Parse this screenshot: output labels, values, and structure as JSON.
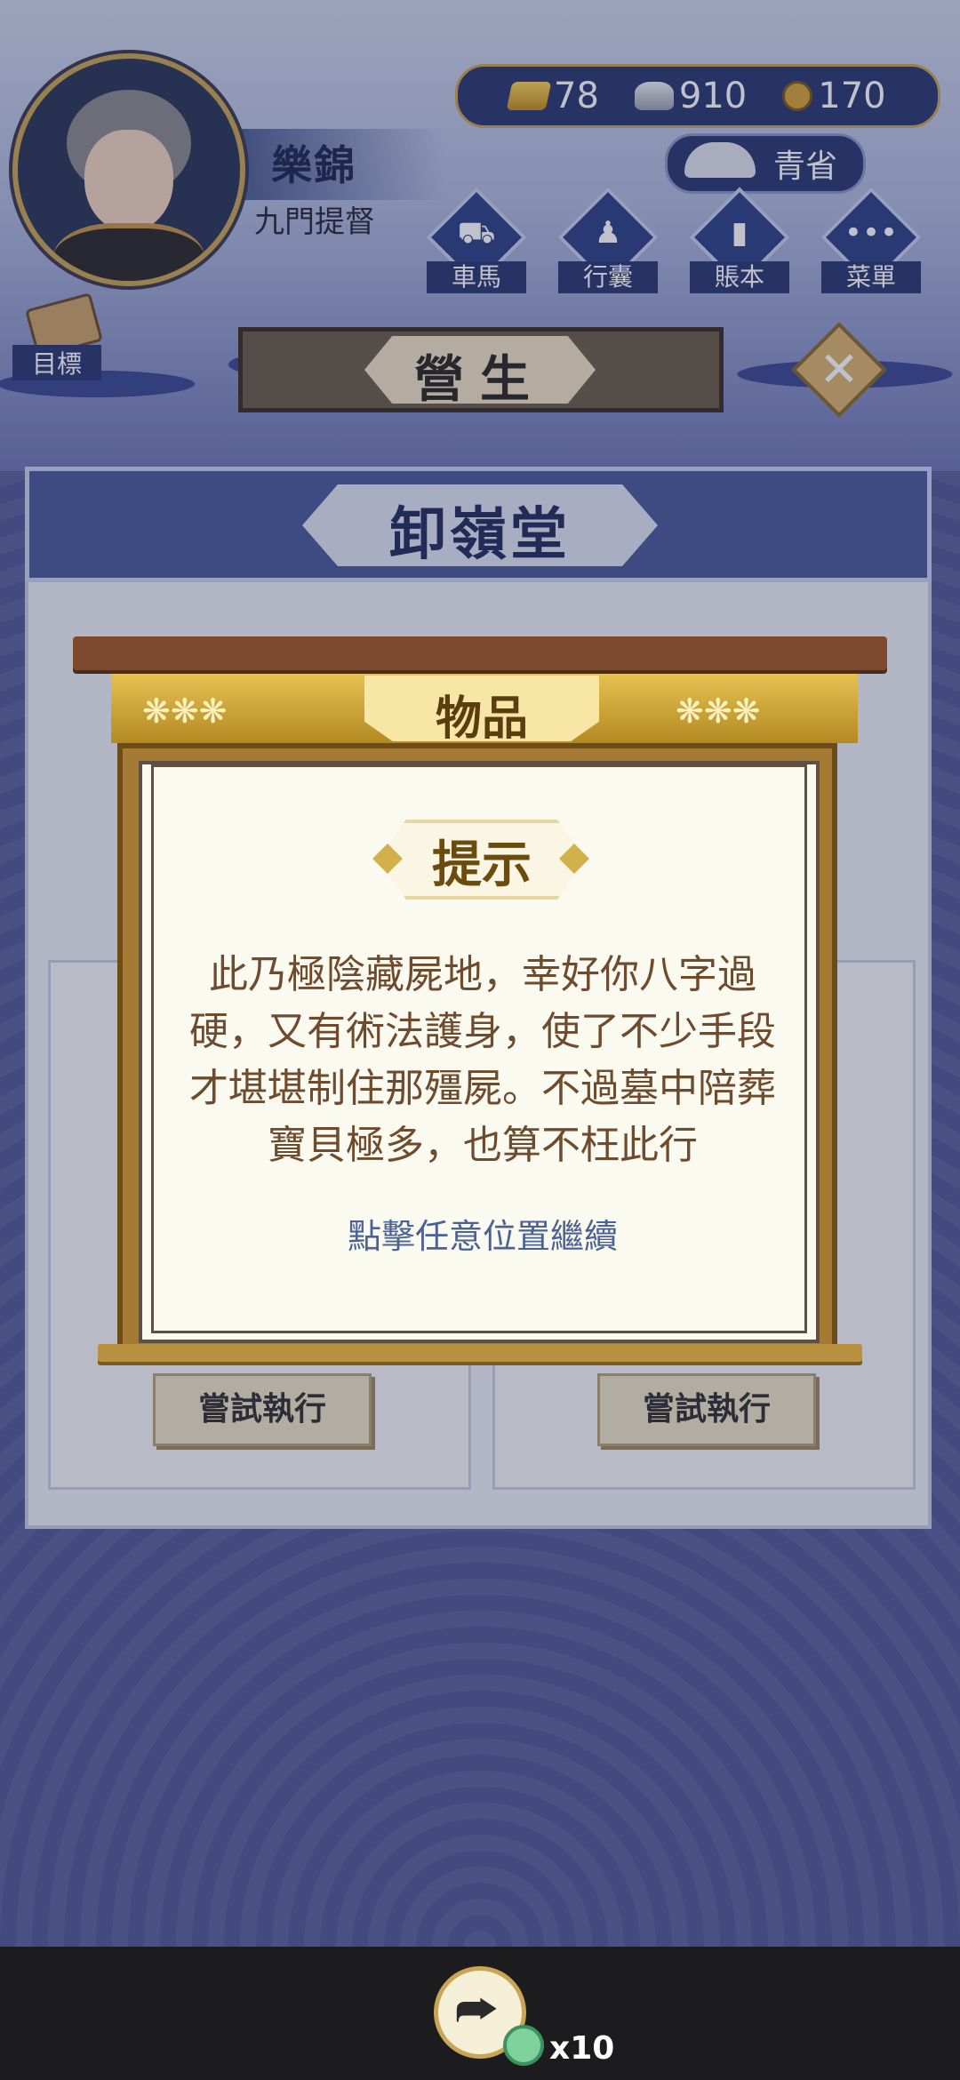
{
  "player": {
    "name": "樂錦",
    "title": "九門提督"
  },
  "resources": [
    {
      "icon": "gold-ingot-icon",
      "value": "78"
    },
    {
      "icon": "silver-icon",
      "value": "910"
    },
    {
      "icon": "copper-coin-icon",
      "value": "170"
    }
  ],
  "season": {
    "label": "青省"
  },
  "menu": [
    {
      "label": "車馬",
      "icon": "carriage-icon"
    },
    {
      "label": "行囊",
      "icon": "bag-icon"
    },
    {
      "label": "賬本",
      "icon": "ledger-icon"
    },
    {
      "label": "菜單",
      "icon": "more-icon"
    }
  ],
  "goal": {
    "label": "目標"
  },
  "section": {
    "title": "營生"
  },
  "panel": {
    "title": "卸嶺堂",
    "buttons": [
      "嘗試執行",
      "嘗試執行"
    ]
  },
  "dialog": {
    "tab": "物品",
    "heading": "提示",
    "message": "此乃極陰藏屍地，幸好你八字過硬，又有術法護身，使了不少手段才堪堪制住那殭屍。不過墓中陪葬寶貝極多，也算不枉此行",
    "continue": "點擊任意位置繼續"
  },
  "share": {
    "count": "x10"
  },
  "colors": {
    "accent_gold": "#c8a655",
    "panel_blue": "#4b5c9c",
    "text_brown": "#6d4b2c"
  }
}
